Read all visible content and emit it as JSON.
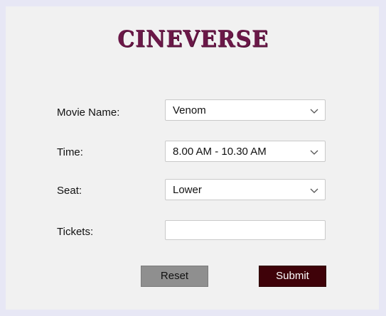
{
  "app": {
    "title": "CINEVERSE"
  },
  "form": {
    "movie": {
      "label": "Movie Name:",
      "selected": "Venom"
    },
    "time": {
      "label": "Time:",
      "selected": "8.00 AM - 10.30 AM"
    },
    "seat": {
      "label": "Seat:",
      "selected": "Lower"
    },
    "tickets": {
      "label": "Tickets:",
      "value": ""
    }
  },
  "buttons": {
    "reset_label": "Reset",
    "submit_label": "Submit"
  },
  "colors": {
    "title": "#6b1848",
    "submit_bg": "#3f0209",
    "reset_bg": "#8f8f8f",
    "window_bg": "#f1f1f1",
    "frame": "#e7e7f5"
  },
  "icons": {
    "dropdown": "chevron-down-icon"
  }
}
